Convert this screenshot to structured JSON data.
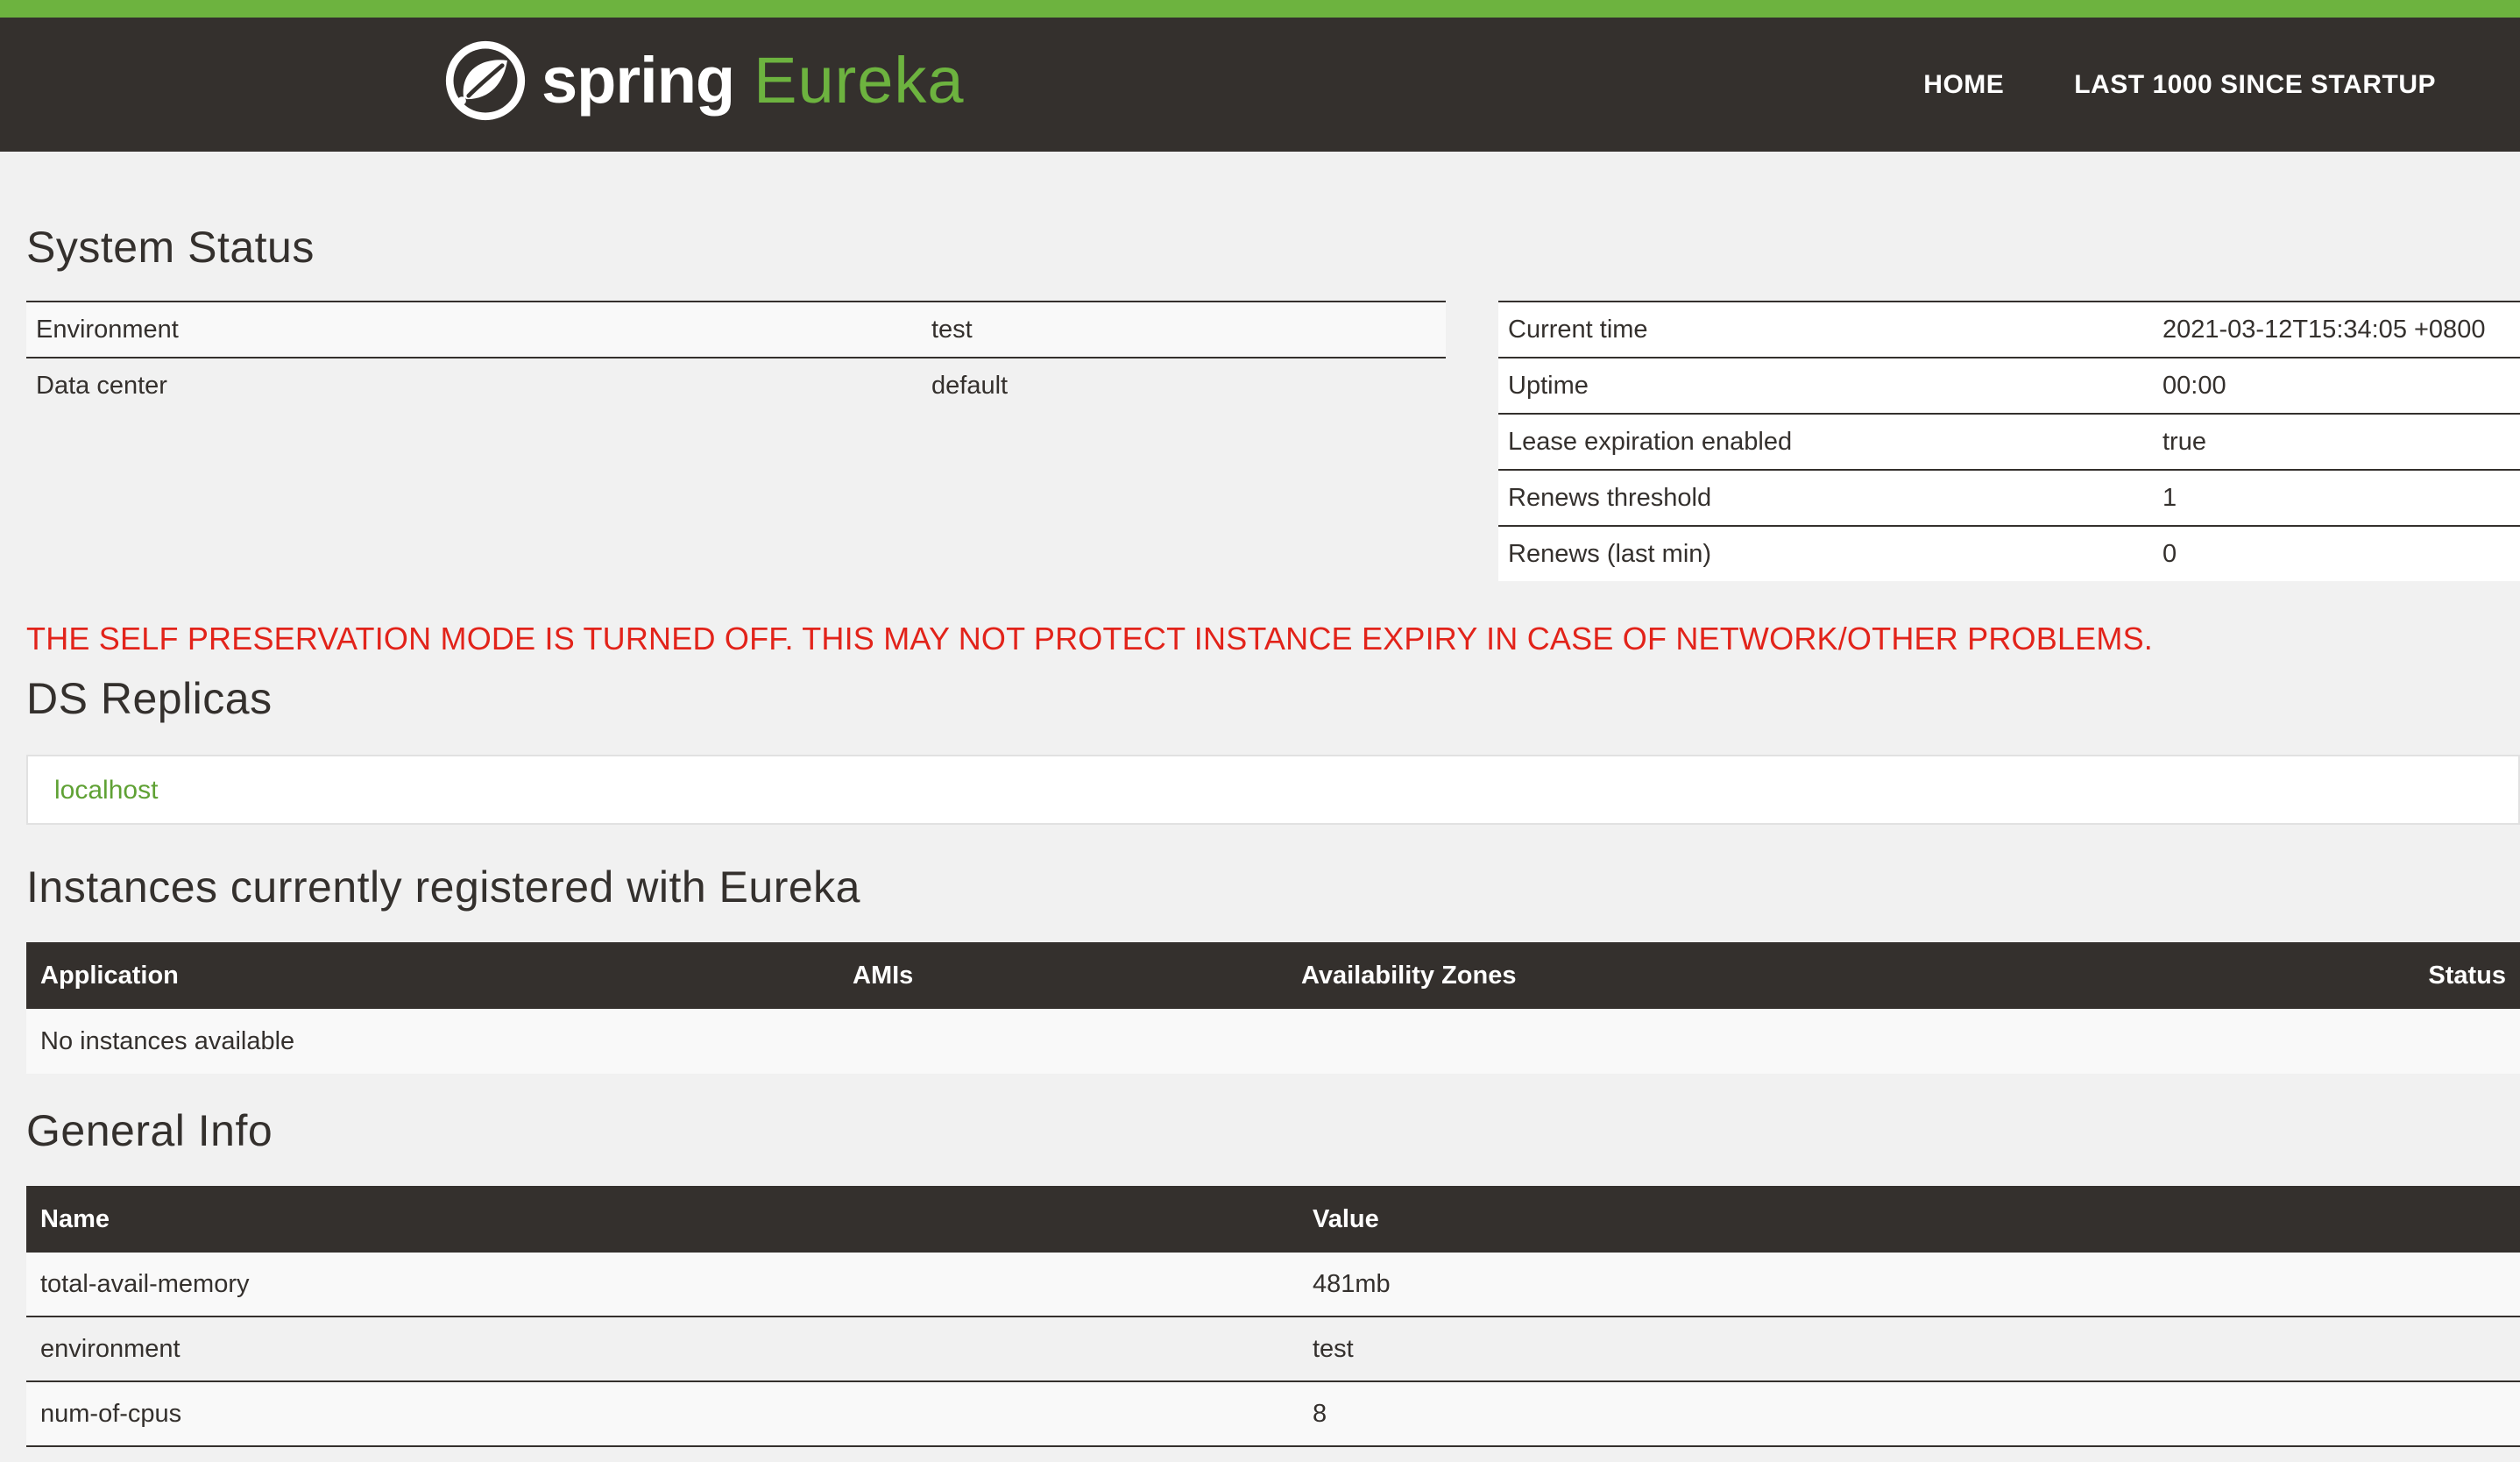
{
  "header": {
    "brand_spring": "spring",
    "brand_eureka": "Eureka",
    "nav": [
      "HOME",
      "LAST 1000 SINCE STARTUP"
    ]
  },
  "system_status": {
    "title": "System Status",
    "left": [
      {
        "label": "Environment",
        "value": "test"
      },
      {
        "label": "Data center",
        "value": "default"
      }
    ],
    "right": [
      {
        "label": "Current time",
        "value": "2021-03-12T15:34:05 +0800"
      },
      {
        "label": "Uptime",
        "value": "00:00"
      },
      {
        "label": "Lease expiration enabled",
        "value": "true"
      },
      {
        "label": "Renews threshold",
        "value": "1"
      },
      {
        "label": "Renews (last min)",
        "value": "0"
      }
    ]
  },
  "warning": "THE SELF PRESERVATION MODE IS TURNED OFF. THIS MAY NOT PROTECT INSTANCE EXPIRY IN CASE OF NETWORK/OTHER PROBLEMS.",
  "ds_replicas": {
    "title": "DS Replicas",
    "items": [
      "localhost"
    ]
  },
  "instances": {
    "title": "Instances currently registered with Eureka",
    "columns": [
      "Application",
      "AMIs",
      "Availability Zones",
      "Status"
    ],
    "empty_text": "No instances available"
  },
  "general_info": {
    "title": "General Info",
    "columns": [
      "Name",
      "Value"
    ],
    "rows": [
      {
        "name": "total-avail-memory",
        "value": "481mb"
      },
      {
        "name": "environment",
        "value": "test"
      },
      {
        "name": "num-of-cpus",
        "value": "8"
      }
    ]
  },
  "colors": {
    "brand_green": "#6db33f",
    "navbar_bg": "#34302d",
    "warning_red": "#e2231a"
  }
}
